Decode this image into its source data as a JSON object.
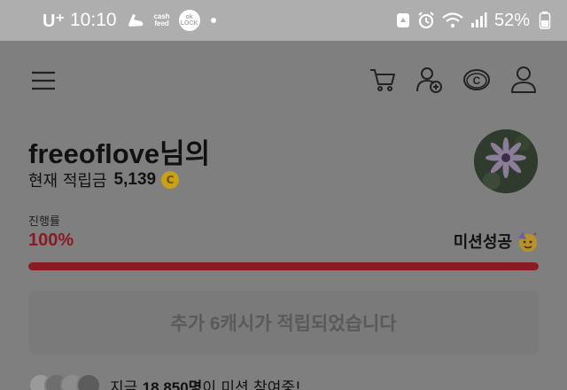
{
  "status_bar": {
    "carrier": "U⁺",
    "time": "10:10",
    "cash_feed_label": "cash feed",
    "ok_lock_label": "ok LOCK",
    "battery": "52%",
    "icons": [
      "recycle-icon",
      "alarm-icon",
      "wifi-icon",
      "signal-icon",
      "battery-icon"
    ]
  },
  "header": {
    "icons": [
      "menu-icon",
      "cart-icon",
      "add-friend-icon",
      "cash-c-icon",
      "profile-icon"
    ]
  },
  "profile": {
    "username": "freeoflove님의",
    "points_label": "현재 적립금",
    "points_value": "5,139",
    "coin_symbol": "C"
  },
  "progress": {
    "label": "진행률",
    "percent_text": "100%",
    "fraction": 1.0,
    "mission_status": "미션성공",
    "bar_color": "#8a1b22"
  },
  "reward_button": {
    "label": "추가 6캐시가 적립되었습니다"
  },
  "participants": {
    "text_prefix": "지금",
    "count": "18,850명",
    "text_suffix": "이 미션 참여중!"
  }
}
